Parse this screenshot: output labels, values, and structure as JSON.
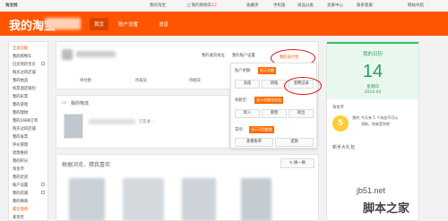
{
  "topbar": {
    "logo": "淘宝网",
    "my_taobao": "我的淘宝",
    "cart_label": "我的购物车",
    "cart_count": "12",
    "favorites": "收藏夹",
    "mobile": "手机版",
    "categories": "商品分类",
    "seller_center": "卖家中心",
    "contact": "联系客服",
    "sitemap": "网站导航"
  },
  "header": {
    "brand": "我的淘宝",
    "nav": [
      "首页",
      "账户设置",
      "消息"
    ]
  },
  "sidebar": {
    "items": [
      "全部功能",
      "我的购物车",
      "已买到的宝贝",
      "购买过的店铺",
      "我的拍卖",
      "机票酒店保险",
      "我的彩票",
      "我的游戏",
      "我的理财",
      "我的1688订单",
      "购买过的店铺",
      "我的发票",
      "评价管理",
      "退款维权",
      "我的积分",
      "淘金币",
      "我的足迹",
      "账户设置",
      "我的店铺",
      "我的网商",
      "最近使用",
      "爱淘宝"
    ]
  },
  "profile": {
    "shipping_link": "我的收货地址",
    "security_link": "我的账户设置",
    "assets_link": "我的支付宝",
    "stats": [
      "待付款",
      "待发货",
      "待收货",
      "待评价"
    ]
  },
  "popup": {
    "balance_label": "账户余额:",
    "balance_value": "显示余额",
    "recharge": "充值",
    "transfer": "转账",
    "bill": "消费记录",
    "yuebao_label": "余额宝:",
    "yuebao_value": "显示余额宝收益",
    "transfer_in": "转入",
    "manage": "管理",
    "transfer_out": "转出",
    "huabei_label": "花呗:",
    "huabei_value": "显示可用额度",
    "check_bill": "查看账单",
    "repay": "还款"
  },
  "logistics": {
    "title": "我的物流",
    "note": "已签收 ..."
  },
  "recommend": {
    "title": "根据浏览，猜我喜欢",
    "refresh": "换一换"
  },
  "calendar": {
    "title": "我的日历",
    "day": "14",
    "weekday": "星期四",
    "date": "2016.04"
  },
  "taojinbi": {
    "label": "淘金币",
    "coins": "5",
    "tip_1": "我的：",
    "tip_2": "今天有 5 个淘金币可以",
    "tip_3": "领取，快来签到吧",
    "gift": "新手大礼包"
  },
  "watermark": {
    "url": "jb51.net",
    "name": "脚本之家"
  }
}
